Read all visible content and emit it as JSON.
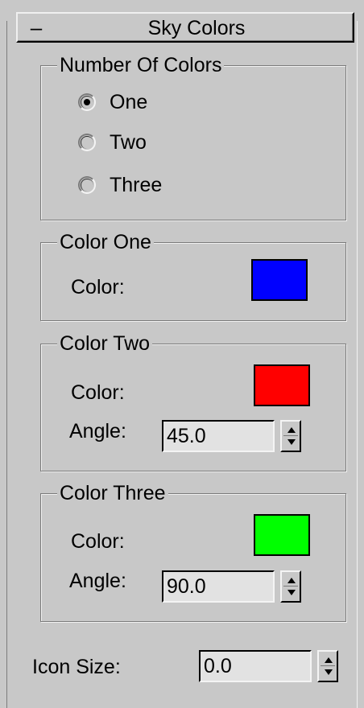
{
  "rollout": {
    "collapse_symbol": "–",
    "title": "Sky Colors"
  },
  "number_of_colors": {
    "title": "Number Of Colors",
    "options": [
      {
        "label": "One",
        "checked": true
      },
      {
        "label": "Two",
        "checked": false
      },
      {
        "label": "Three",
        "checked": false
      }
    ]
  },
  "color_one": {
    "title": "Color One",
    "color_label": "Color:",
    "color": "#0000ff"
  },
  "color_two": {
    "title": "Color Two",
    "color_label": "Color:",
    "color": "#ff0000",
    "angle_label": "Angle:",
    "angle_value": "45.0"
  },
  "color_three": {
    "title": "Color Three",
    "color_label": "Color:",
    "color": "#00ff00",
    "angle_label": "Angle:",
    "angle_value": "90.0"
  },
  "icon_size": {
    "label": "Icon Size:",
    "value": "0.0"
  },
  "icons": {
    "spinner": "up-down-arrows-icon",
    "radio": "radio-button-icon"
  }
}
